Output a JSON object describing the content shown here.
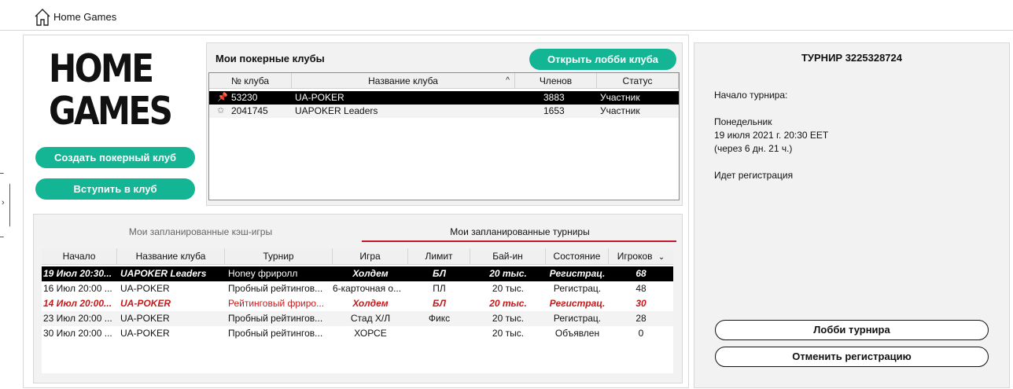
{
  "window": {
    "title": "Home Games"
  },
  "logo": {
    "line1": "HOME",
    "line2": "GAMES"
  },
  "buttons": {
    "create_club": "Создать покерный клуб",
    "join_club": "Вступить в клуб",
    "open_lobby": "Открыть лобби клуба",
    "tournament_lobby": "Лобби турнира",
    "cancel_registration": "Отменить регистрацию"
  },
  "clubs": {
    "title": "Мои покерные клубы",
    "columns": [
      "№ клуба",
      "Название клуба",
      "Членов",
      "Статус"
    ],
    "rows": [
      {
        "id": "53230",
        "name": "UA-POKER",
        "members": "3883",
        "status": "Участник",
        "pinned": true
      },
      {
        "id": "2041745",
        "name": "UAPOKER Leaders",
        "members": "1653",
        "status": "Участник",
        "pinned": false
      }
    ]
  },
  "tabs": {
    "cash": "Мои запланированные кэш-игры",
    "tournaments": "Мои запланированные турниры"
  },
  "tournaments": {
    "columns": [
      "Начало",
      "Название клуба",
      "Турнир",
      "Игра",
      "Лимит",
      "Бай-ин",
      "Состояние",
      "Игроков"
    ],
    "rows": [
      {
        "start": "19 Июл  20:30...",
        "club": "UAPOKER Leaders",
        "tourney": "Honey фриролл",
        "game": "Холдем",
        "limit": "БЛ",
        "buyin": "20 тыс.",
        "state": "Регистрац.",
        "players": "68"
      },
      {
        "start": "16 Июл  20:00 ...",
        "club": "UA-POKER",
        "tourney": "Пробный рейтингов...",
        "game": "6-карточная о...",
        "limit": "ПЛ",
        "buyin": "20 тыс.",
        "state": "Регистрац.",
        "players": "48"
      },
      {
        "start": "14 Июл  20:00...",
        "club": "UA-POKER",
        "tourney": "Рейтинговый фриро...",
        "game": "Холдем",
        "limit": "БЛ",
        "buyin": "20 тыс.",
        "state": "Регистрац.",
        "players": "30"
      },
      {
        "start": "23 Июл  20:00 ...",
        "club": "UA-POKER",
        "tourney": "Пробный рейтингов...",
        "game": "Стад Х/Л",
        "limit": "Фикс",
        "buyin": "20 тыс.",
        "state": "Регистрац.",
        "players": "28"
      },
      {
        "start": "30 Июл  20:00 ...",
        "club": "UA-POKER",
        "tourney": "Пробный рейтингов...",
        "game": "ХОРСЕ",
        "limit": "",
        "buyin": "20 тыс.",
        "state": "Объявлен",
        "players": "0"
      }
    ]
  },
  "tournament_info": {
    "title": "ТУРНИР 3225328724",
    "start_label": "Начало турнира:",
    "day": "Понедельник",
    "date": "19 июля 2021 г. 20:30 EET",
    "countdown": "(через 6 дн. 21 ч.)",
    "status": "Идет регистрация"
  },
  "colors": {
    "accent_green": "#14b594",
    "tab_underline": "#c0182a",
    "highlight_red": "#c41a1a"
  }
}
